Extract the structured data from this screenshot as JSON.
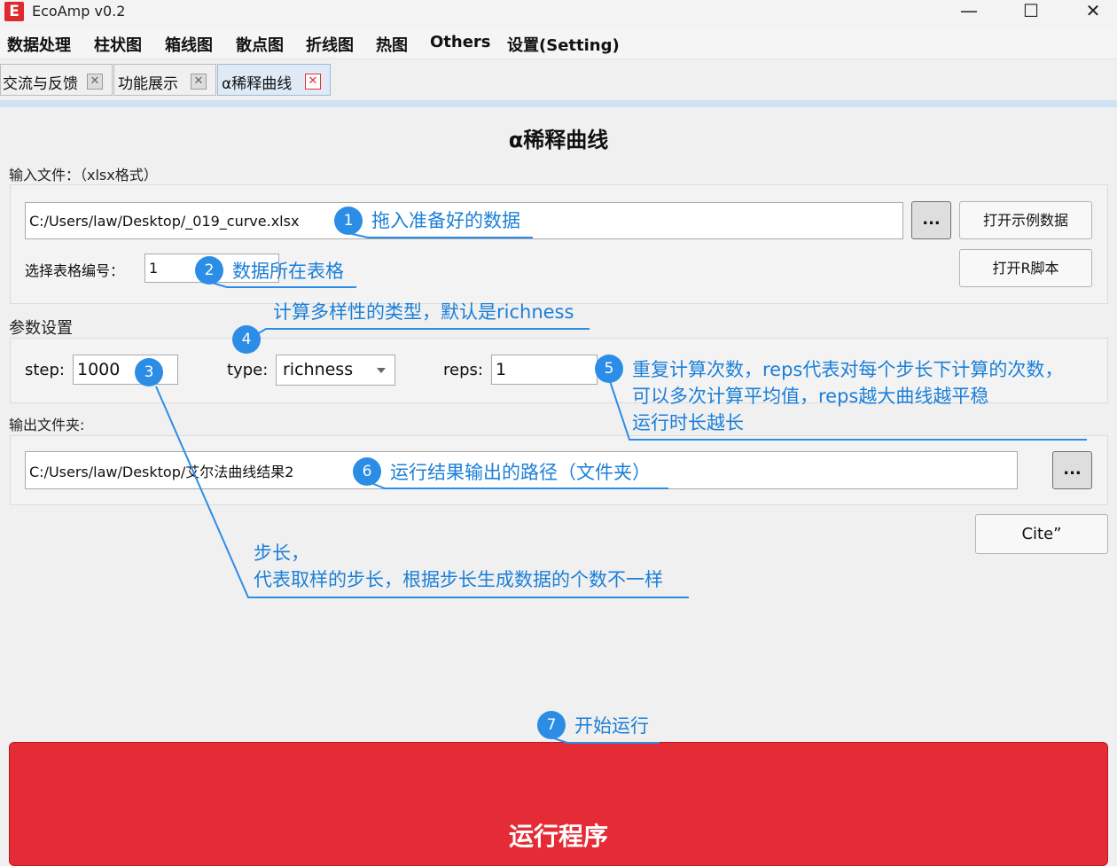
{
  "window": {
    "app_logo": "E",
    "title": "EcoAmp v0.2",
    "minimize": "—",
    "maximize": "☐",
    "close": "✕"
  },
  "menu": [
    "数据处理",
    "柱状图",
    "箱线图",
    "散点图",
    "折线图",
    "热图",
    "Others",
    "设置(Setting)"
  ],
  "tabs": [
    {
      "label": "交流与反馈",
      "close": "✕"
    },
    {
      "label": "功能展示",
      "close": "✕"
    },
    {
      "label": "α稀释曲线",
      "close": "✕",
      "active": true
    }
  ],
  "page_title": "α稀释曲线",
  "input_section": {
    "label": "输入文件：（xlsx格式）",
    "file_path": "C:/Users/law/Desktop/_019_curve.xlsx",
    "browse_label": "...",
    "open_example_label": "打开示例数据",
    "sheet_label": "选择表格编号：",
    "sheet_value": "1",
    "open_r_script_label": "打开R脚本"
  },
  "params_section": {
    "label": "参数设置",
    "step_label": "step:",
    "step_value": "1000",
    "type_label": "type:",
    "type_value": "richness",
    "reps_label": "reps:",
    "reps_value": "1"
  },
  "output_section": {
    "label": "输出文件夹:",
    "folder_path": "C:/Users/law/Desktop/艾尔法曲线结果2",
    "browse_label": "..."
  },
  "cite_label": "Cite”",
  "run_label": "运行程序",
  "annotations": [
    {
      "num": "1",
      "text": "拖入准备好的数据"
    },
    {
      "num": "2",
      "text": "数据所在表格"
    },
    {
      "num": "3",
      "text": "步长，\n代表取样的步长，根据步长生成数据的个数不一样"
    },
    {
      "num": "4",
      "text": "计算多样性的类型，默认是richness"
    },
    {
      "num": "5",
      "text": "重复计算次数，reps代表对每个步长下计算的次数，\n可以多次计算平均值，reps越大曲线越平稳\n运行时长越长"
    },
    {
      "num": "6",
      "text": "运行结果输出的路径（文件夹）"
    },
    {
      "num": "7",
      "text": "开始运行"
    }
  ],
  "colors": {
    "accent_blue": "#2c8de6",
    "annotation_blue": "#1b7fd8",
    "run_red": "#e52b35",
    "active_tab": "#dfeaf6"
  }
}
